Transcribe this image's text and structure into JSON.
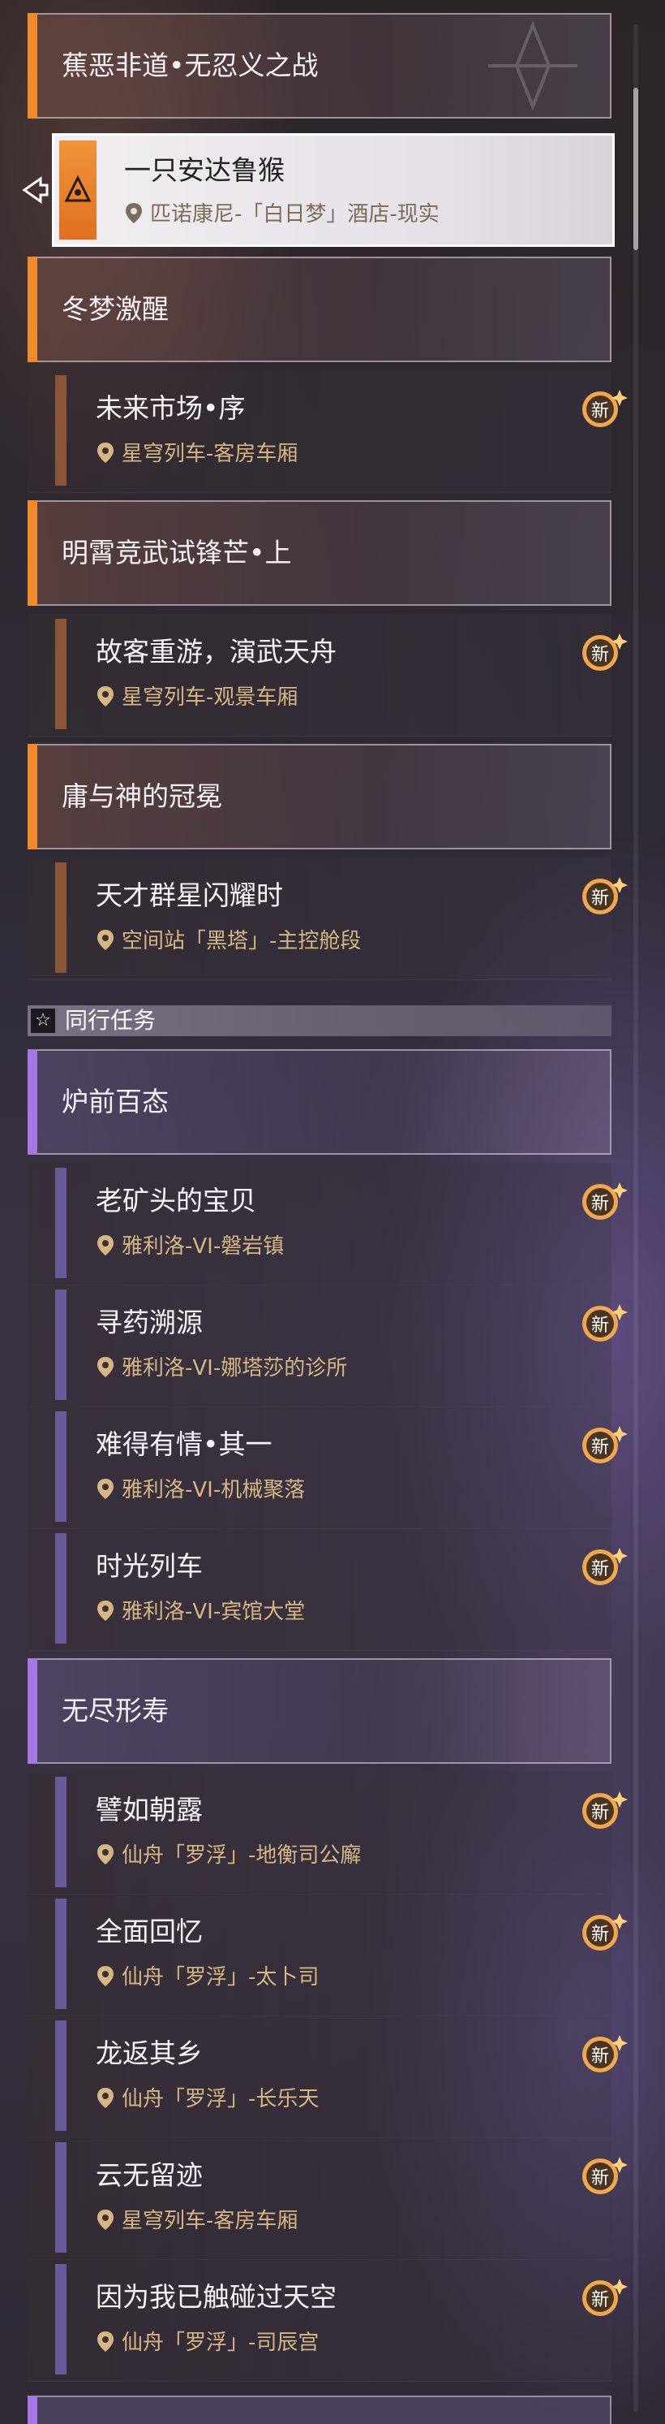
{
  "chapters": [
    {
      "title": "蕉恶非道•无忍义之战"
    },
    {
      "title": "冬梦激醒"
    },
    {
      "title": "明霄竞武试锋芒•上"
    },
    {
      "title": "庸与神的冠冕"
    },
    {
      "title": "炉前百态"
    },
    {
      "title": "无尽形寿"
    }
  ],
  "active_quest": {
    "title": "一只安达鲁猴",
    "location": "匹诺康尼-「白日梦」酒店-现实"
  },
  "quests": [
    {
      "title": "未来市场•序",
      "location": "星穹列车-客房车厢",
      "badge": "新"
    },
    {
      "title": "故客重游，演武天舟",
      "location": "星穹列车-观景车厢",
      "badge": "新"
    },
    {
      "title": "天才群星闪耀时",
      "location": "空间站「黑塔」-主控舱段",
      "badge": "新"
    },
    {
      "title": "老矿头的宝贝",
      "location": "雅利洛-VI-磐岩镇",
      "badge": "新"
    },
    {
      "title": "寻药溯源",
      "location": "雅利洛-VI-娜塔莎的诊所",
      "badge": "新"
    },
    {
      "title": "难得有情•其一",
      "location": "雅利洛-VI-机械聚落",
      "badge": "新"
    },
    {
      "title": "时光列车",
      "location": "雅利洛-VI-宾馆大堂",
      "badge": "新"
    },
    {
      "title": "譬如朝露",
      "location": "仙舟「罗浮」-地衡司公廨",
      "badge": "新"
    },
    {
      "title": "全面回忆",
      "location": "仙舟「罗浮」-太卜司",
      "badge": "新"
    },
    {
      "title": "龙返其乡",
      "location": "仙舟「罗浮」-长乐天",
      "badge": "新"
    },
    {
      "title": "云无留迹",
      "location": "星穹列车-客房车厢",
      "badge": "新"
    },
    {
      "title": "因为我已触碰过天空",
      "location": "仙舟「罗浮」-司辰宫",
      "badge": "新"
    }
  ],
  "section": {
    "label": "同行任务",
    "icon": "star-icon"
  },
  "colors": {
    "accent_orange": "#f08a2a",
    "accent_violet": "#a777e6",
    "location_text": "#d6b784"
  }
}
